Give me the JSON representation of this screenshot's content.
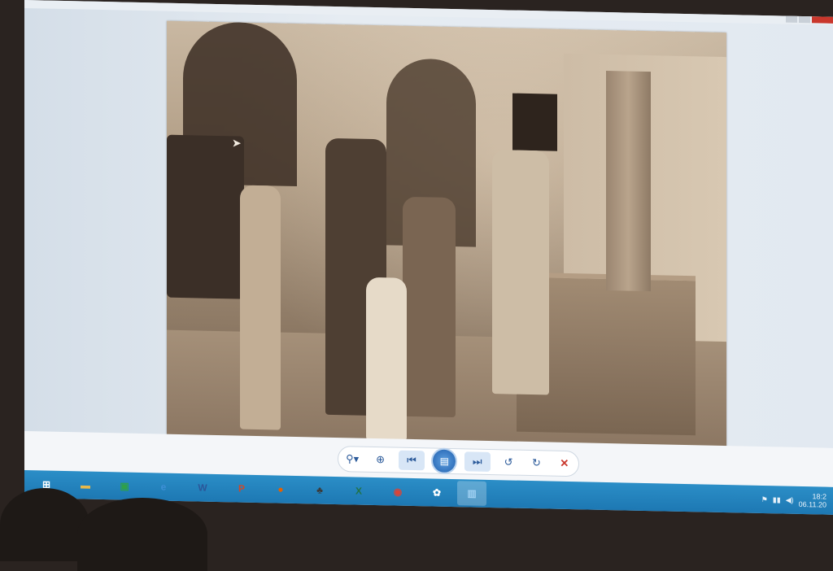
{
  "viewer": {
    "title_controls": [
      "minimize",
      "maximize",
      "close"
    ],
    "photo": {
      "icons": {
        "cursor": "mouse-pointer-icon"
      }
    },
    "toolbar": {
      "icons": {
        "zoom": "zoom-icon",
        "actual_size": "actual-size-icon",
        "previous": "previous-icon",
        "slideshow": "slideshow-icon",
        "next": "next-icon",
        "rotate_left": "rotate-counterclockwise-icon",
        "rotate_right": "rotate-clockwise-icon",
        "delete": "delete-icon"
      },
      "glyphs": {
        "zoom": "⚲▾",
        "actual_size": "⊕",
        "previous": "⏮",
        "slideshow": "▤",
        "next": "⏭",
        "rotate_left": "↺",
        "rotate_right": "↻",
        "delete": "✕"
      }
    }
  },
  "taskbar": {
    "items": [
      {
        "name": "start-icon",
        "glyph": "⊞",
        "color": "#ffffff"
      },
      {
        "name": "file-explorer-icon",
        "glyph": "▬",
        "color": "#e8b94a"
      },
      {
        "name": "store-icon",
        "glyph": "▣",
        "color": "#2ea04a"
      },
      {
        "name": "ie-icon",
        "glyph": "e",
        "color": "#3d8fd6"
      },
      {
        "name": "word-icon",
        "glyph": "W",
        "color": "#2b579a"
      },
      {
        "name": "powerpoint-icon",
        "glyph": "P",
        "color": "#d24726"
      },
      {
        "name": "firefox-icon",
        "glyph": "●",
        "color": "#e66000"
      },
      {
        "name": "app-icon",
        "glyph": "♣",
        "color": "#3b3b3b"
      },
      {
        "name": "excel-icon",
        "glyph": "X",
        "color": "#217346"
      },
      {
        "name": "chrome-icon",
        "glyph": "◉",
        "color": "#db4437"
      },
      {
        "name": "picasa-icon",
        "glyph": "✿",
        "color": "#ffffff"
      },
      {
        "name": "photo-viewer-icon",
        "glyph": "▥",
        "color": "#9fd0f2"
      }
    ],
    "tray": {
      "icons": [
        "flag-icon",
        "network-icon",
        "volume-icon"
      ],
      "time": "18:2",
      "date": "06.11.20"
    }
  },
  "colors": {
    "taskbar": "#1d78b3",
    "close": "#c9372c",
    "accent": "#2b5a9a"
  }
}
